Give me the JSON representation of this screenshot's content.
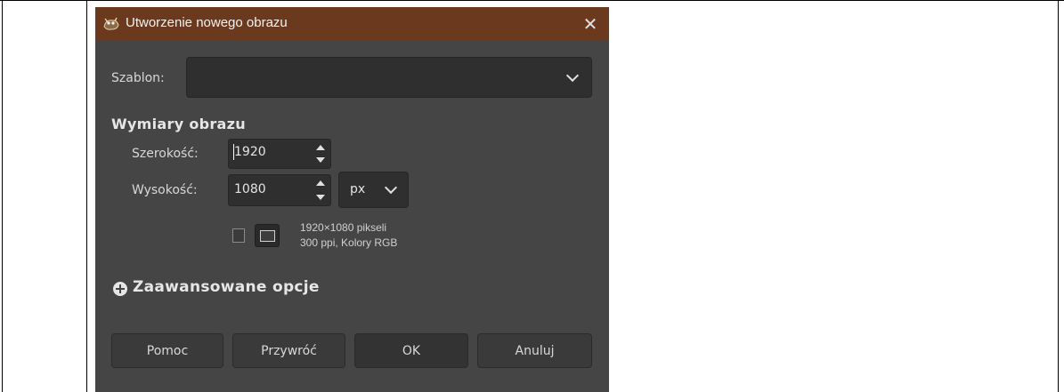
{
  "dialog": {
    "title": "Utworzenie nowego obrazu",
    "close_glyph": "✕",
    "titlebar_color": "#6b3a1e",
    "bg_color": "#454545"
  },
  "template": {
    "label": "Szablon:",
    "value": ""
  },
  "dimensions": {
    "section_title": "Wymiary obrazu",
    "width_label": "Szerokość:",
    "width_value": "1920",
    "height_label": "Wysokość:",
    "height_value": "1080",
    "unit": "px"
  },
  "info": {
    "size_line": "1920×1080 pikseli",
    "res_line": "300 ppi, Kolory RGB"
  },
  "advanced": {
    "label": "Zaawansowane opcje"
  },
  "buttons": {
    "help": "Pomoc",
    "reset": "Przywróć",
    "ok": "OK",
    "cancel": "Anuluj"
  },
  "icons": {
    "app": "gimp-wilber-icon",
    "portrait": "portrait-orientation-icon",
    "landscape": "landscape-orientation-icon",
    "expand": "plus-circle-icon"
  }
}
